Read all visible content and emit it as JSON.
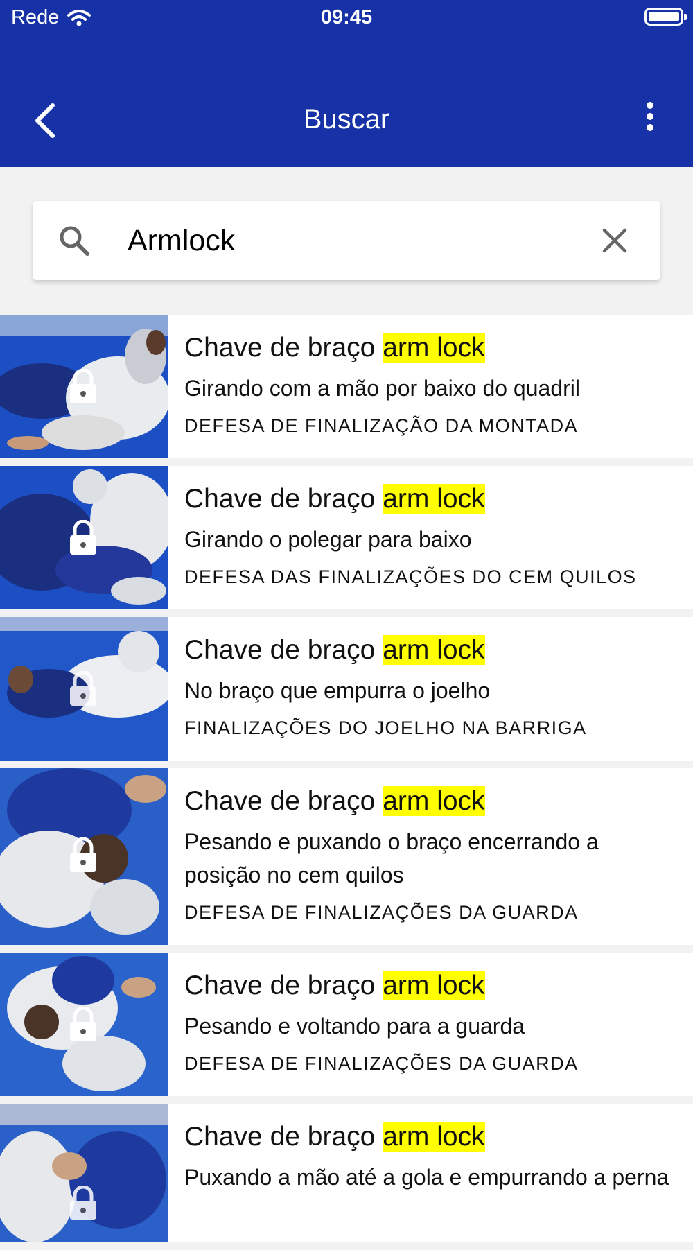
{
  "status_bar": {
    "carrier": "Rede",
    "time": "09:45"
  },
  "header": {
    "title": "Buscar"
  },
  "search": {
    "value": "Armlock"
  },
  "colors": {
    "primary": "#1632a6",
    "highlight": "#ffff00"
  },
  "results": [
    {
      "title": "Chave de braço ",
      "highlight": "arm lock",
      "subtitle": "Girando com a mão por baixo do quadril",
      "category": "DEFESA DE FINALIZAÇÃO DA MONTADA",
      "locked": true
    },
    {
      "title": "Chave de braço ",
      "highlight": "arm lock",
      "subtitle": "Girando o polegar para baixo",
      "category": "DEFESA DAS FINALIZAÇÕES DO CEM QUILOS",
      "locked": true
    },
    {
      "title": "Chave de braço ",
      "highlight": "arm lock",
      "subtitle": "No braço que empurra o joelho",
      "category": "FINALIZAÇÕES DO JOELHO NA BARRIGA",
      "locked": true
    },
    {
      "title": "Chave de braço ",
      "highlight": "arm lock",
      "subtitle": "Pesando e puxando o braço encerrando a posição no cem quilos",
      "category": "DEFESA DE FINALIZAÇÕES DA GUARDA",
      "locked": true
    },
    {
      "title": "Chave de braço ",
      "highlight": "arm lock",
      "subtitle": "Pesando e voltando para a guarda",
      "category": "DEFESA DE FINALIZAÇÕES DA GUARDA",
      "locked": true
    },
    {
      "title": "Chave de braço ",
      "highlight": "arm lock",
      "subtitle": "Puxando a mão até a gola e empurrando a perna",
      "category": "",
      "locked": true
    }
  ]
}
